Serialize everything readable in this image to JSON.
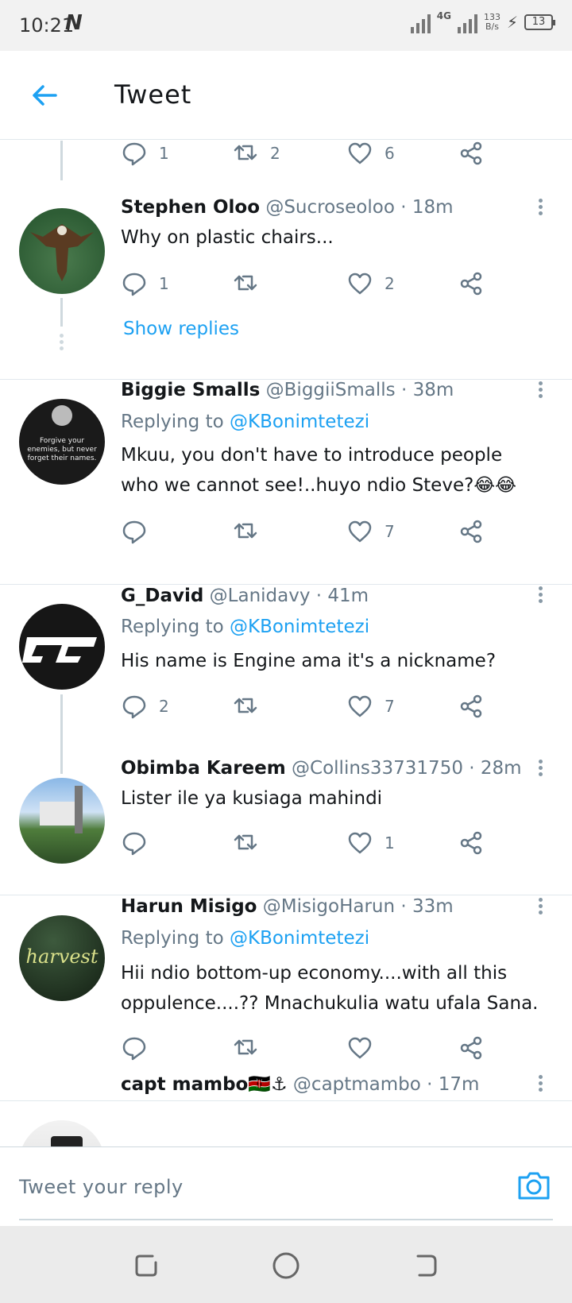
{
  "status_bar": {
    "time": "10:21",
    "carrier_glyph": "N",
    "network_type": "4G",
    "net_speed_value": "133",
    "net_speed_unit": "B/s",
    "battery": "13"
  },
  "header": {
    "title": "Tweet"
  },
  "top_actions": {
    "replies": "1",
    "retweets": "2",
    "likes": "6"
  },
  "tweets": [
    {
      "name": "Stephen Oloo",
      "meta": "@Sucroseoloo · 18m",
      "replying_prefix": "",
      "replying_to": "",
      "text": "Why on plastic chairs...",
      "replies": "1",
      "retweets": "",
      "likes": "2"
    },
    {
      "name": "Biggie Smalls",
      "meta": "@BiggiiSmalls · 38m",
      "replying_prefix": "Replying to ",
      "replying_to": "@KBonimtetezi",
      "text": "Mkuu, you don't have to introduce people who we cannot see!..huyo ndio Steve?😂😂",
      "replies": "",
      "retweets": "",
      "likes": "7",
      "avatar_text": "Forgive your enemies, but never forget their names."
    },
    {
      "name": "G_David",
      "meta": "@Lanidavy · 41m",
      "replying_prefix": "Replying to ",
      "replying_to": "@KBonimtetezi",
      "text": "His name is Engine ama it's a nickname?",
      "replies": "2",
      "retweets": "",
      "likes": "7"
    },
    {
      "name": "Obimba Kareem",
      "meta": "@Collins33731750 · 28m",
      "replying_prefix": "",
      "replying_to": "",
      "text": "Lister ile ya kusiaga mahindi",
      "replies": "",
      "retweets": "",
      "likes": "1"
    },
    {
      "name": "Harun Misigo",
      "meta": "@MisigoHarun · 33m",
      "replying_prefix": "Replying to ",
      "replying_to": "@KBonimtetezi",
      "text": "Hii ndio bottom-up economy....with all this oppulence....??  Mnachukulia watu ufala Sana.",
      "replies": "",
      "retweets": "",
      "likes": "",
      "avatar_text": "harvest"
    },
    {
      "name": "capt mambo🇰🇪⚓",
      "meta": "@captmambo · 17m"
    }
  ],
  "show_replies_label": "Show replies",
  "reply_bar": {
    "placeholder": "Tweet your reply"
  },
  "colors": {
    "accent": "#1da1f2",
    "secondary_text": "#657786",
    "divider": "#e1e8ed"
  },
  "icons": [
    "back-arrow-icon",
    "reply-icon",
    "retweet-icon",
    "like-icon",
    "share-icon",
    "more-icon",
    "camera-icon"
  ]
}
